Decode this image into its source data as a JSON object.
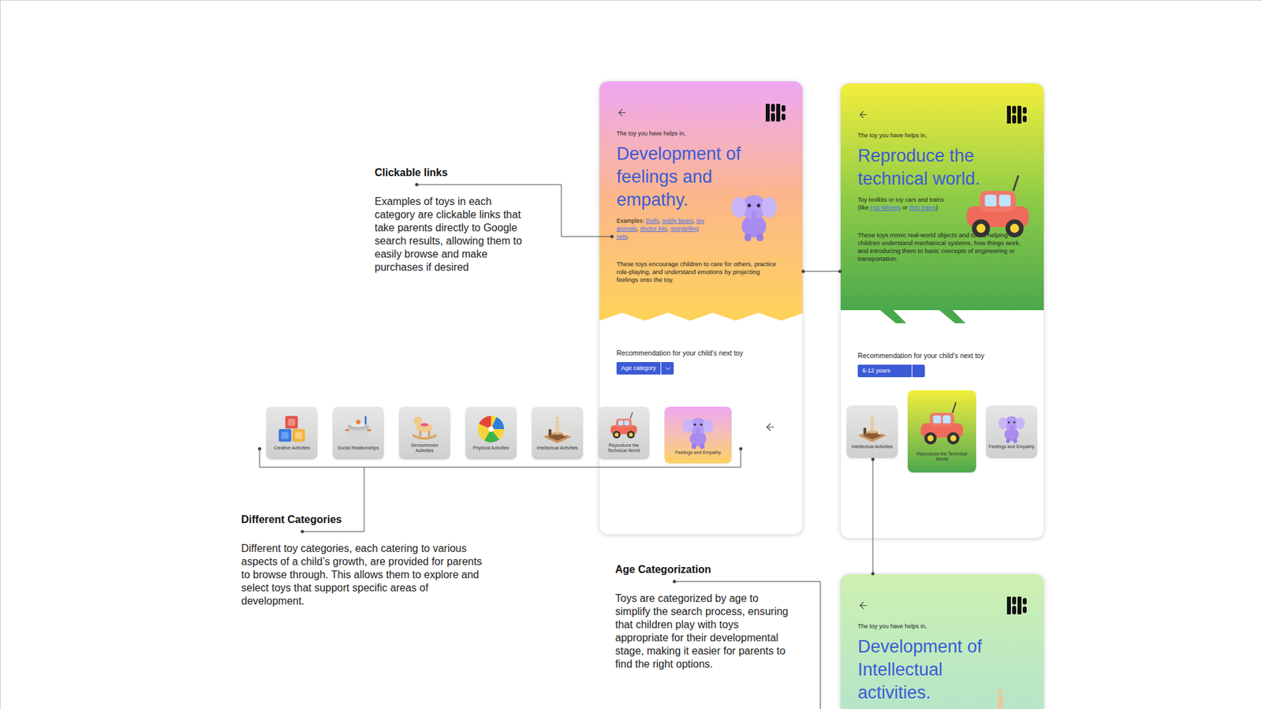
{
  "annotations": [
    {
      "title": "Clickable links",
      "body": "Examples of toys in each category are clickable links that take parents directly to Google search results, allowing them to easily browse and make purchases if desired"
    },
    {
      "title": "Different Categories",
      "body": "Different toy categories, each catering to various aspects of a child’s growth, are provided for parents to browse through. This allows them to explore and select toys that support specific areas of development."
    },
    {
      "title": "Age Categorization",
      "body": "Toys are categorized by age to simplify the search process, ensuring that children play with toys appropriate for their developmental stage, making it easier for parents to find the right options."
    }
  ],
  "category_strip": {
    "tiles": [
      {
        "label": "Creative Activities",
        "kind": "blocks",
        "selected": false
      },
      {
        "label": "Social Relationships",
        "kind": "pot",
        "selected": false
      },
      {
        "label": "Sensorimotor Activities",
        "kind": "horse",
        "selected": false
      },
      {
        "label": "Physical Activities",
        "kind": "ball",
        "selected": false
      },
      {
        "label": "Intellectual Activities",
        "kind": "chess",
        "selected": false
      },
      {
        "label": "Reproduce the Technical World",
        "kind": "car",
        "selected": false
      },
      {
        "label": "Feelings and Empathy",
        "kind": "elephant",
        "selected": true
      }
    ]
  },
  "phones": [
    {
      "kind": "feelings",
      "intro": "The toy you have helps in,",
      "heading": "Development of feelings and empathy.",
      "examples": [
        {
          "text": "Examples: ",
          "link": false
        },
        {
          "text": "Dolls",
          "link": true
        },
        {
          "text": ", ",
          "link": false
        },
        {
          "text": "teddy bears",
          "link": true
        },
        {
          "text": ", ",
          "link": false
        },
        {
          "text": "toy animals",
          "link": true
        },
        {
          "text": ", ",
          "link": false
        },
        {
          "text": "doctor kits",
          "link": true
        },
        {
          "text": ", ",
          "link": false
        },
        {
          "text": "storytelling sets",
          "link": true
        },
        {
          "text": ".",
          "link": false
        }
      ],
      "description": "These toys encourage children to care for others, practice role-playing, and understand emotions by projecting feelings onto the toy.",
      "recommendation": "Recommendation for your child’s next toy",
      "age_select": "Age category",
      "tiles": []
    },
    {
      "kind": "technical",
      "intro": "The toy you have helps in,",
      "heading": "Reproduce the technical world.",
      "examples": [
        {
          "text": "Toy toolkits or toy cars and trains (like ",
          "link": false
        },
        {
          "text": "Hot Wheels",
          "link": true
        },
        {
          "text": " or ",
          "link": false
        },
        {
          "text": "Brio trains",
          "link": true
        },
        {
          "text": ")",
          "link": false
        }
      ],
      "description": "These toys mimic real-world objects and tools, helping children understand mechanical systems, how things work, and introducing them to basic concepts of engineering or transportation.",
      "recommendation": "Recommendation for your child’s next toy",
      "age_select": "6-12 years",
      "tiles": [
        {
          "label": "Intellectual Activities",
          "kind": "chess",
          "selected": false
        },
        {
          "label": "Reproduce the Technical World",
          "kind": "car",
          "selected": true
        },
        {
          "label": "Feelings and Empathy",
          "kind": "elephant",
          "selected": false
        }
      ]
    },
    {
      "kind": "intellectual",
      "intro": "The toy you have helps in,",
      "heading": "Development of Intellectual activities.",
      "examples": [],
      "description": "",
      "recommendation": "",
      "age_select": "",
      "tiles": []
    }
  ]
}
